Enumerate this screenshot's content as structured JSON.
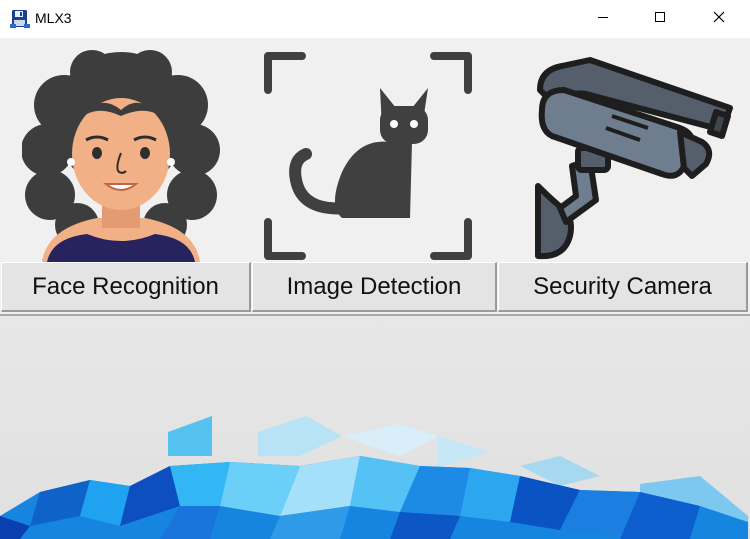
{
  "window": {
    "title": "MLX3",
    "app_icon": "floppy-disk-icon",
    "controls": [
      "minimize-icon",
      "maximize-icon",
      "close-icon"
    ]
  },
  "tools": [
    {
      "label": "Face Recognition",
      "icon": "woman-face-icon"
    },
    {
      "label": "Image Detection",
      "icon": "cat-detection-frame-icon"
    },
    {
      "label": "Security Camera",
      "icon": "cctv-camera-icon"
    }
  ],
  "banner": {
    "image": "blue-polygon-mosaic"
  },
  "colors": {
    "face_hair": "#3d3d3d",
    "face_skin": "#f2b086",
    "face_shirt": "#27235e",
    "icon_dark": "#404040",
    "camera_body": "#6f7e8f",
    "mosaic_blue": "#1585e0"
  }
}
